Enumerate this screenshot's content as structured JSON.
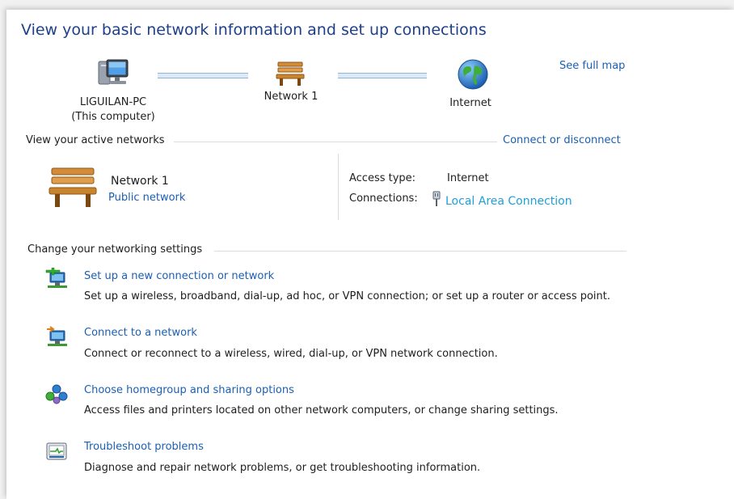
{
  "title": "View your basic network information and set up connections",
  "map": {
    "see_full_map": "See full map",
    "computer_name": "LIGUILAN-PC",
    "computer_sub": "(This computer)",
    "network_name": "Network 1",
    "internet_label": "Internet"
  },
  "active": {
    "section_label": "View your active networks",
    "connect_link": "Connect or disconnect",
    "network_name": "Network 1",
    "network_type": "Public network",
    "access_type_label": "Access type:",
    "access_type_value": "Internet",
    "connections_label": "Connections:",
    "connection_link": "Local Area Connection"
  },
  "change": {
    "section_label": "Change your networking settings",
    "tasks": [
      {
        "title": "Set up a new connection or network",
        "desc": "Set up a wireless, broadband, dial-up, ad hoc, or VPN connection; or set up a router or access point.",
        "icon": "new-connection-icon"
      },
      {
        "title": "Connect to a network",
        "desc": "Connect or reconnect to a wireless, wired, dial-up, or VPN network connection.",
        "icon": "connect-network-icon"
      },
      {
        "title": "Choose homegroup and sharing options",
        "desc": "Access files and printers located on other network computers, or change sharing settings.",
        "icon": "homegroup-icon"
      },
      {
        "title": "Troubleshoot problems",
        "desc": "Diagnose and repair network problems, or get troubleshooting information.",
        "icon": "troubleshoot-icon"
      }
    ]
  }
}
